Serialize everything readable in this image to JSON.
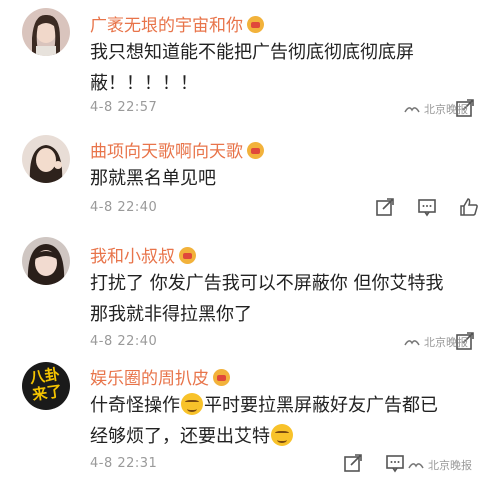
{
  "comments": [
    {
      "username": "广袤无垠的宇宙和你",
      "lines": [
        "我只想知道能不能把广告彻底彻底彻底屏",
        "蔽！！！！！"
      ],
      "time": "4-8 22:57",
      "watermark": "北京晚报",
      "actions": [
        "share-icon",
        "watermark"
      ]
    },
    {
      "username": "曲项向天歌啊向天歌",
      "lines": [
        "那就黑名单见吧"
      ],
      "time": "4-8 22:40",
      "actions": [
        "share-icon",
        "comment-icon",
        "like-icon"
      ]
    },
    {
      "username": "我和小叔叔",
      "lines": [
        "打扰了 你发广告我可以不屏蔽你 但你艾特我",
        "那我就非得拉黑你了"
      ],
      "time": "4-8 22:40",
      "watermark": "北京晚报",
      "actions": [
        "share-icon",
        "watermark"
      ]
    },
    {
      "username": "娱乐圈的周扒皮",
      "line1_a": "什奇怪操作",
      "line1_b": "平时要拉黑屏蔽好友广告都已",
      "line2": "经够烦了，还要出艾特",
      "time": "4-8 22:31",
      "watermark": "北京晚报",
      "avatar_text_top": "八卦",
      "avatar_text_bottom": "来了",
      "actions": [
        "share-icon",
        "comment-icon",
        "watermark"
      ]
    }
  ],
  "colors": {
    "username": "#e8744a",
    "badge": "#f2b23b",
    "time": "#9a9a9a",
    "avatar4_bg": "#1a1a1a",
    "avatar4_text": "#f5c400"
  }
}
